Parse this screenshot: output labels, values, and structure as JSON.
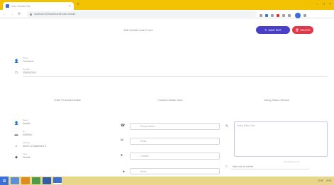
{
  "browser": {
    "tab_title": "Vote Details Edit",
    "tab_close": "×",
    "new_tab": "+",
    "url": "localhost:4200/admin/edit-voter-details",
    "window_controls": [
      "–",
      "□",
      "×"
    ]
  },
  "nav": {
    "back": "←",
    "forward": "→",
    "reload": "⟳"
  },
  "page": {
    "title": "Edit Details Voter Form",
    "save_label": "SAVE EDIT",
    "delete_label": "DELETE"
  },
  "top_fields": [
    {
      "label": "Name",
      "value": "Full Name",
      "icon": "person-icon"
    },
    {
      "label": "Number",
      "value": "0000000000",
      "icon": "id-card-icon"
    }
  ],
  "sections": {
    "personal": "Voter Personal Details",
    "contact": "Contact Details Voter",
    "status": "Voting Status Section"
  },
  "personal_fields": [
    {
      "label": "Name",
      "value": "Details",
      "icon": "person-icon"
    },
    {
      "label": "ID",
      "value": "0000000",
      "icon": "card-icon"
    },
    {
      "label": "Address",
      "value": "Street 12 Apartment 4",
      "icon": "home-icon"
    },
    {
      "label": "Area",
      "value": "District",
      "icon": "pin-icon"
    }
  ],
  "contact_fields": [
    {
      "placeholder": "Phone number",
      "icon": "phone-icon"
    },
    {
      "placeholder": "Email",
      "icon": "mail-icon"
    },
    {
      "placeholder": "Location",
      "icon": "location-icon"
    },
    {
      "placeholder": "Notes",
      "icon": "note-icon"
    }
  ],
  "status": {
    "textarea_placeholder": "Voting Status Text",
    "checkbox_label": "Mark vote as verified",
    "note": "last updated just now"
  },
  "taskbar": {
    "start_label": "⊞",
    "time": "12:30",
    "date": "2019"
  }
}
